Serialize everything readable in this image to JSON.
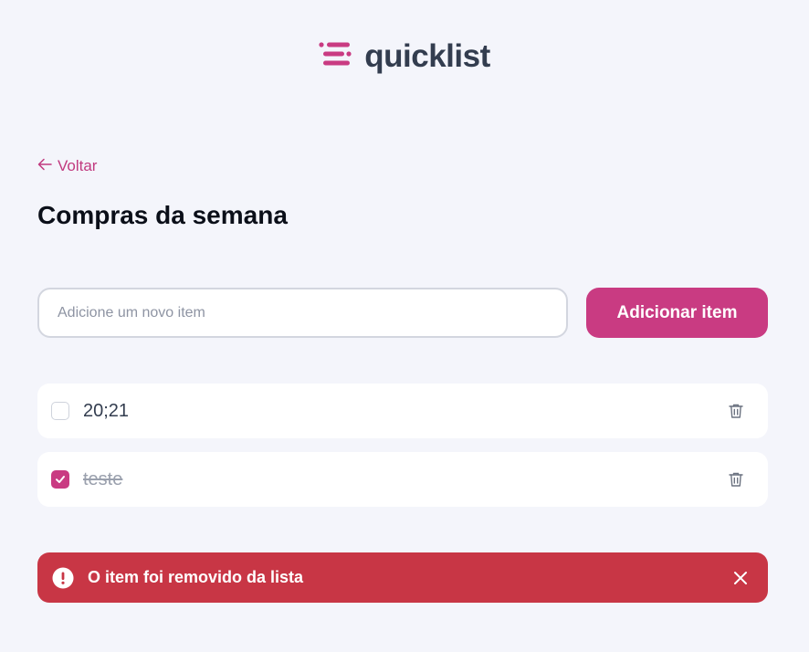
{
  "header": {
    "logo_text": "quicklist",
    "logo_icon": "list-lines-icon",
    "brand_color": "#c93b82"
  },
  "nav": {
    "back_label": "Voltar",
    "back_icon": "arrow-left-icon"
  },
  "page": {
    "title": "Compras da semana"
  },
  "add_form": {
    "input_value": "",
    "input_placeholder": "Adicione um novo item",
    "button_label": "Adicionar item"
  },
  "items": [
    {
      "label": "20;21",
      "checked": false
    },
    {
      "label": "teste",
      "checked": true
    }
  ],
  "toast": {
    "message": "O item foi removido da lista",
    "icon": "alert-circle-icon",
    "close_icon": "close-icon",
    "color": "#c83645"
  }
}
